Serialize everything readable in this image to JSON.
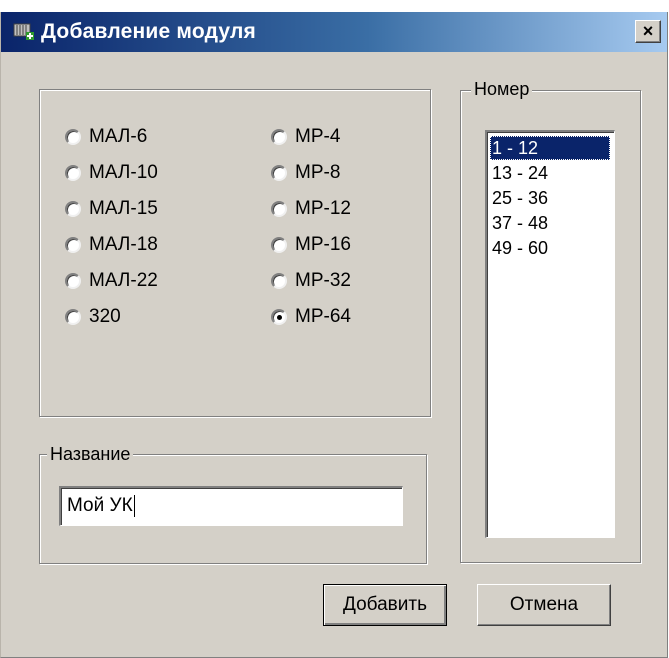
{
  "window": {
    "title": "Добавление модуля",
    "close_label": "×"
  },
  "modules": {
    "left": [
      {
        "label": "МАЛ-6",
        "checked": false
      },
      {
        "label": "МАЛ-10",
        "checked": false
      },
      {
        "label": "МАЛ-15",
        "checked": false
      },
      {
        "label": "МАЛ-18",
        "checked": false
      },
      {
        "label": "МАЛ-22",
        "checked": false
      },
      {
        "label": "320",
        "checked": false
      }
    ],
    "right": [
      {
        "label": "МР-4",
        "checked": false
      },
      {
        "label": "МР-8",
        "checked": false
      },
      {
        "label": "МР-12",
        "checked": false
      },
      {
        "label": "МР-16",
        "checked": false
      },
      {
        "label": "МР-32",
        "checked": false
      },
      {
        "label": "МР-64",
        "checked": true
      }
    ]
  },
  "number_group": {
    "legend": "Номер",
    "items": [
      "1 - 12",
      "13 - 24",
      "25 - 36",
      "37 - 48",
      "49 - 60"
    ],
    "selected": "1 - 12"
  },
  "name_group": {
    "legend": "Название",
    "value": "Мой УК"
  },
  "buttons": {
    "add": "Добавить",
    "cancel": "Отмена"
  }
}
